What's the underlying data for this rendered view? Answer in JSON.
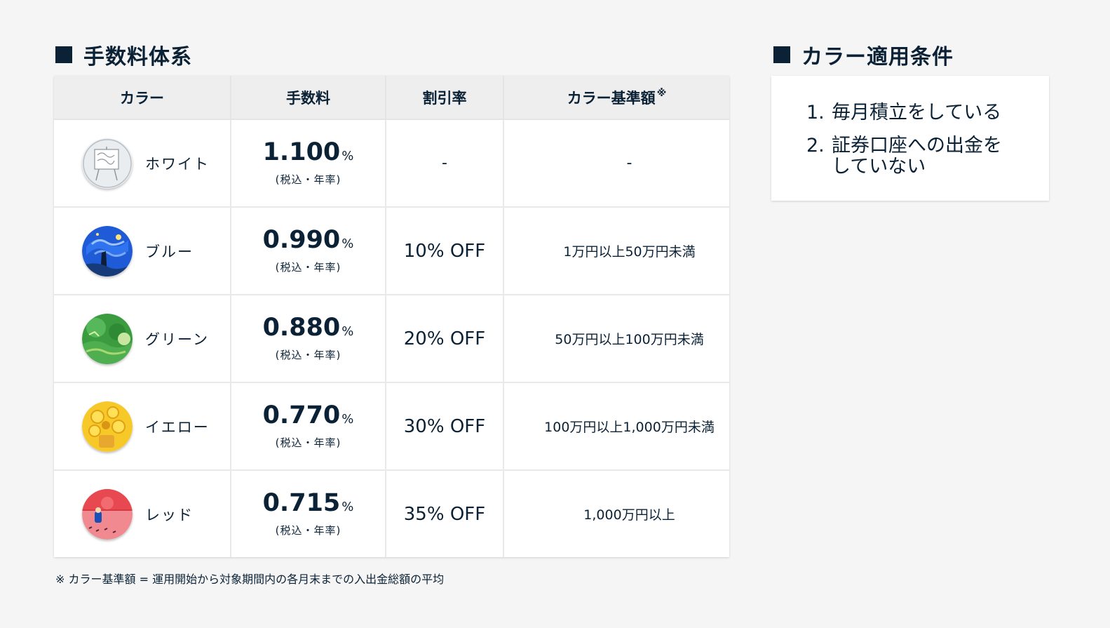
{
  "fee_section": {
    "title": "手数料体系",
    "headers": {
      "color": "カラー",
      "fee": "手数料",
      "discount": "割引率",
      "base": "カラー基準額",
      "base_mark": "※"
    },
    "rows": [
      {
        "color": "ホワイト",
        "icon": "white-painting-icon",
        "fee": "1.100",
        "pct": "%",
        "note": "(税込・年率)",
        "discount": "-",
        "discount_off": "",
        "base": "-"
      },
      {
        "color": "ブルー",
        "icon": "blue-painting-icon",
        "fee": "0.990",
        "pct": "%",
        "note": "(税込・年率)",
        "discount": "10",
        "discount_off": "% OFF",
        "base": "1万円以上50万円未満"
      },
      {
        "color": "グリーン",
        "icon": "green-painting-icon",
        "fee": "0.880",
        "pct": "%",
        "note": "(税込・年率)",
        "discount": "20",
        "discount_off": "% OFF",
        "base": "50万円以上100万円未満"
      },
      {
        "color": "イエロー",
        "icon": "yellow-painting-icon",
        "fee": "0.770",
        "pct": "%",
        "note": "(税込・年率)",
        "discount": "30",
        "discount_off": "% OFF",
        "base": "100万円以上1,000万円未満"
      },
      {
        "color": "レッド",
        "icon": "red-painting-icon",
        "fee": "0.715",
        "pct": "%",
        "note": "(税込・年率)",
        "discount": "35",
        "discount_off": "% OFF",
        "base": "1,000万円以上"
      }
    ],
    "footnote": "※ カラー基準額 = 運用開始から対象期間内の各月末までの入出金総額の平均"
  },
  "condition_section": {
    "title": "カラー適用条件",
    "items": [
      {
        "num": "1.",
        "text": "毎月積立をしている"
      },
      {
        "num": "2.",
        "text": "証券口座への出金をしていない"
      }
    ]
  },
  "colors": {
    "text": "#0b2236",
    "header_bg": "#eeeeee",
    "white": "#e8ecef",
    "blue": "#1f5bd6",
    "green": "#3a9b3f",
    "yellow": "#f7c928",
    "red": "#e8484f"
  }
}
